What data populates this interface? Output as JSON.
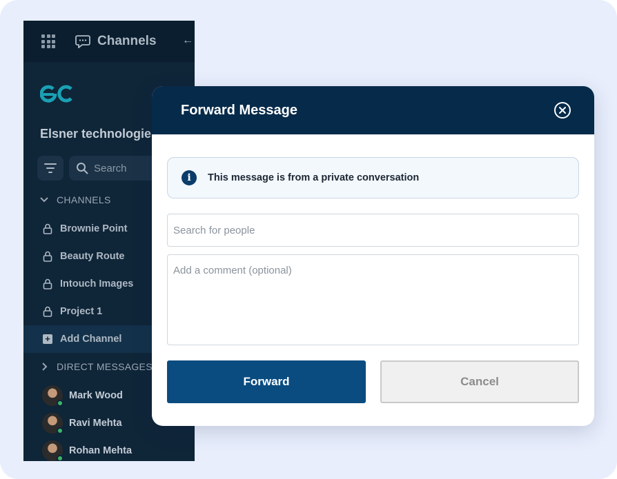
{
  "sidebar": {
    "header_title": "Channels",
    "org_name": "Elsner technologies",
    "search_placeholder": "Search",
    "channels_section": "CHANNELS",
    "channels": [
      {
        "label": "Brownie Point"
      },
      {
        "label": "Beauty Route"
      },
      {
        "label": "Intouch Images"
      },
      {
        "label": "Project 1"
      }
    ],
    "add_channel_label": "Add Channel",
    "direct_messages_section": "DIRECT MESSAGES",
    "direct_messages": [
      {
        "name": "Mark Wood",
        "status": "online"
      },
      {
        "name": "Ravi Mehta",
        "status": "online"
      },
      {
        "name": "Rohan Mehta",
        "status": "online"
      }
    ]
  },
  "modal": {
    "title": "Forward Message",
    "info_text": "This message is from a private conversation",
    "search_placeholder": "Search for people",
    "comment_placeholder": "Add a comment (optional)",
    "forward_label": "Forward",
    "cancel_label": "Cancel"
  },
  "colors": {
    "background": "#e8eefc",
    "sidebar": "#0f2538",
    "modal_header": "#062a4a",
    "primary_button": "#0a4c80",
    "logo_accent": "#1aa0b4",
    "online": "#3cb36a"
  },
  "icons": [
    "apps-grid-icon",
    "chat-bubble-icon",
    "arrow-left-icon",
    "filter-icon",
    "search-icon",
    "lock-icon",
    "plus-square-icon",
    "chevron-down-icon",
    "chevron-right-icon",
    "close-circle-icon",
    "info-icon"
  ]
}
